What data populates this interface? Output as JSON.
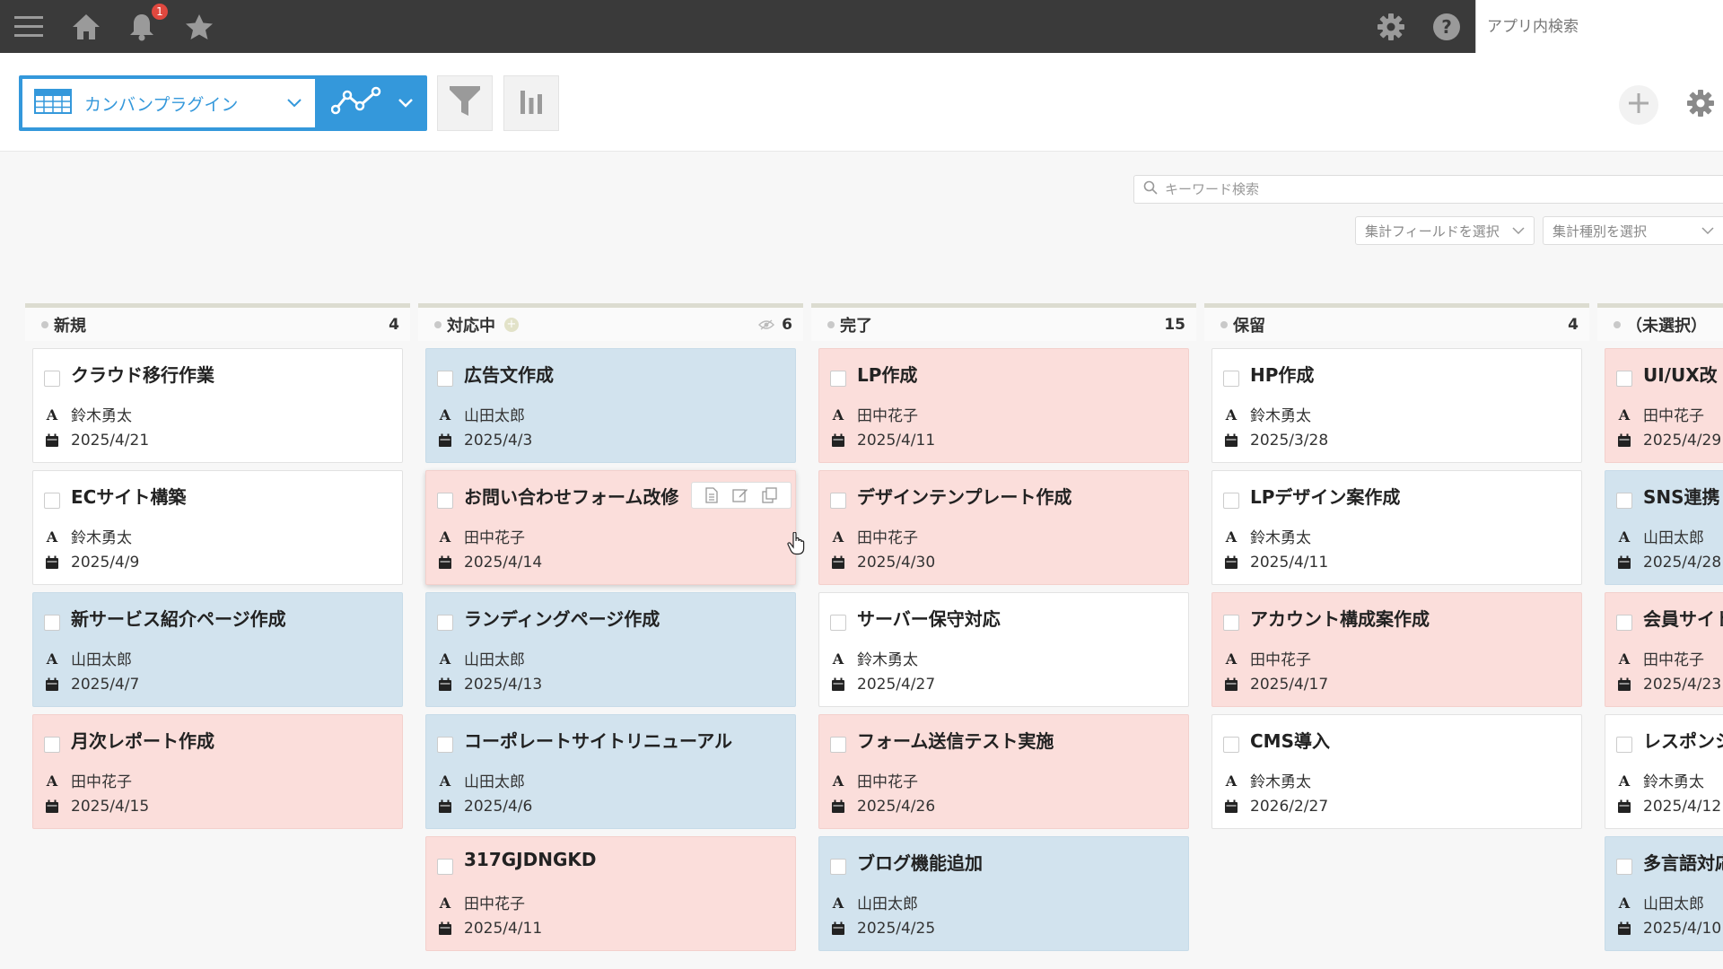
{
  "topbar": {
    "notification_count": "1",
    "app_search_placeholder": "アプリ内検索"
  },
  "toolbar": {
    "view_label": "カンバンプラグイン"
  },
  "search": {
    "keyword_placeholder": "キーワード検索",
    "agg_field_label": "集計フィールドを選択",
    "agg_type_label": "集計種別を選択"
  },
  "colors": {
    "accent": "#3498db",
    "topbar": "#3a3a3a",
    "card_blue": "#d2e3ee",
    "card_pink": "#fbdedb",
    "card_white": "#ffffff"
  },
  "columns": [
    {
      "title": "新規",
      "count": "4",
      "cards": [
        {
          "title": "クラウド移行作業",
          "person": "鈴木勇太",
          "date": "2025/4/21",
          "color": "white"
        },
        {
          "title": "ECサイト構築",
          "person": "鈴木勇太",
          "date": "2025/4/9",
          "color": "white"
        },
        {
          "title": "新サービス紹介ページ作成",
          "person": "山田太郎",
          "date": "2025/4/7",
          "color": "blue"
        },
        {
          "title": "月次レポート作成",
          "person": "田中花子",
          "date": "2025/4/15",
          "color": "pink"
        }
      ]
    },
    {
      "title": "対応中",
      "count": "6",
      "cards": [
        {
          "title": "広告文作成",
          "person": "山田太郎",
          "date": "2025/4/3",
          "color": "blue"
        },
        {
          "title": "お問い合わせフォーム改修",
          "person": "田中花子",
          "date": "2025/4/14",
          "color": "pink"
        },
        {
          "title": "ランディングページ作成",
          "person": "山田太郎",
          "date": "2025/4/13",
          "color": "blue"
        },
        {
          "title": "コーポレートサイトリニューアル",
          "person": "山田太郎",
          "date": "2025/4/6",
          "color": "blue"
        },
        {
          "title": "317GJDNGKD",
          "person": "田中花子",
          "date": "2025/4/11",
          "color": "pink"
        }
      ]
    },
    {
      "title": "完了",
      "count": "15",
      "cards": [
        {
          "title": "LP作成",
          "person": "田中花子",
          "date": "2025/4/11",
          "color": "pink"
        },
        {
          "title": "デザインテンプレート作成",
          "person": "田中花子",
          "date": "2025/4/30",
          "color": "pink"
        },
        {
          "title": "サーバー保守対応",
          "person": "鈴木勇太",
          "date": "2025/4/27",
          "color": "white"
        },
        {
          "title": "フォーム送信テスト実施",
          "person": "田中花子",
          "date": "2025/4/26",
          "color": "pink"
        },
        {
          "title": "ブログ機能追加",
          "person": "山田太郎",
          "date": "2025/4/25",
          "color": "blue"
        }
      ]
    },
    {
      "title": "保留",
      "count": "4",
      "cards": [
        {
          "title": "HP作成",
          "person": "鈴木勇太",
          "date": "2025/3/28",
          "color": "white"
        },
        {
          "title": "LPデザイン案作成",
          "person": "鈴木勇太",
          "date": "2025/4/11",
          "color": "white"
        },
        {
          "title": "アカウント構成案作成",
          "person": "田中花子",
          "date": "2025/4/17",
          "color": "pink"
        },
        {
          "title": "CMS導入",
          "person": "鈴木勇太",
          "date": "2026/2/27",
          "color": "white"
        }
      ]
    },
    {
      "title": "（未選択）",
      "count": "",
      "cards": [
        {
          "title": "UI/UX改",
          "person": "田中花子",
          "date": "2025/4/29",
          "color": "pink"
        },
        {
          "title": "SNS連携",
          "person": "山田太郎",
          "date": "2025/4/28",
          "color": "blue"
        },
        {
          "title": "会員サイト",
          "person": "田中花子",
          "date": "2025/4/23",
          "color": "pink"
        },
        {
          "title": "レスポンシ",
          "person": "鈴木勇太",
          "date": "2025/4/12",
          "color": "white"
        },
        {
          "title": "多言語対応",
          "person": "山田太郎",
          "date": "2025/4/10",
          "color": "blue"
        }
      ]
    }
  ]
}
